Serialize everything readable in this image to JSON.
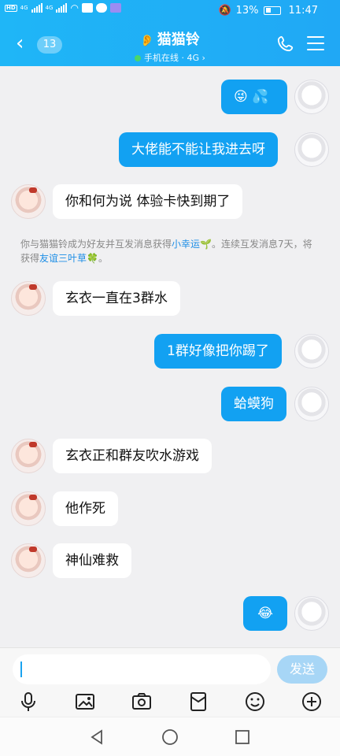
{
  "status": {
    "hd1": "HD",
    "hd2": "HD",
    "net1": "4G",
    "net2": "4G",
    "battery": "13%",
    "time": "11:47"
  },
  "header": {
    "badge": "13",
    "title": "猫猫铃",
    "subtitle": "手机在线 · 4G"
  },
  "messages": [
    {
      "side": "out",
      "text": "😜 💦"
    },
    {
      "side": "out",
      "text": "大佬能不能让我进去呀"
    },
    {
      "side": "in",
      "text": "你和何为说 体验卡快到期了"
    },
    {
      "side": "in",
      "text": "玄衣一直在3群水"
    },
    {
      "side": "out",
      "text": "1群好像把你踢了"
    },
    {
      "side": "out",
      "text": "蛤蟆狗"
    },
    {
      "side": "in",
      "text": "玄衣正和群友吹水游戏"
    },
    {
      "side": "in",
      "text": "他作死"
    },
    {
      "side": "in",
      "text": "神仙难救"
    },
    {
      "side": "out",
      "text": "😂"
    }
  ],
  "system_notice": {
    "part1": "你与猫猫铃成为好友并互发消息获得",
    "link1": "小幸运",
    "icon1": "🌱",
    "part2": "。连续互发消息7天，将获得",
    "link2": "友谊三叶草",
    "icon2": "🍀",
    "part3": "。"
  },
  "input": {
    "placeholder": "",
    "send_label": "发送"
  },
  "toolbar": [
    "mic-icon",
    "picture-icon",
    "camera-icon",
    "red-packet-icon",
    "emoji-icon",
    "plus-icon"
  ],
  "colors": {
    "header": "#1fb6f7",
    "bubble_out": "#12a1f2",
    "link": "#1e8ee6",
    "send_disabled": "#a7d6f6"
  }
}
